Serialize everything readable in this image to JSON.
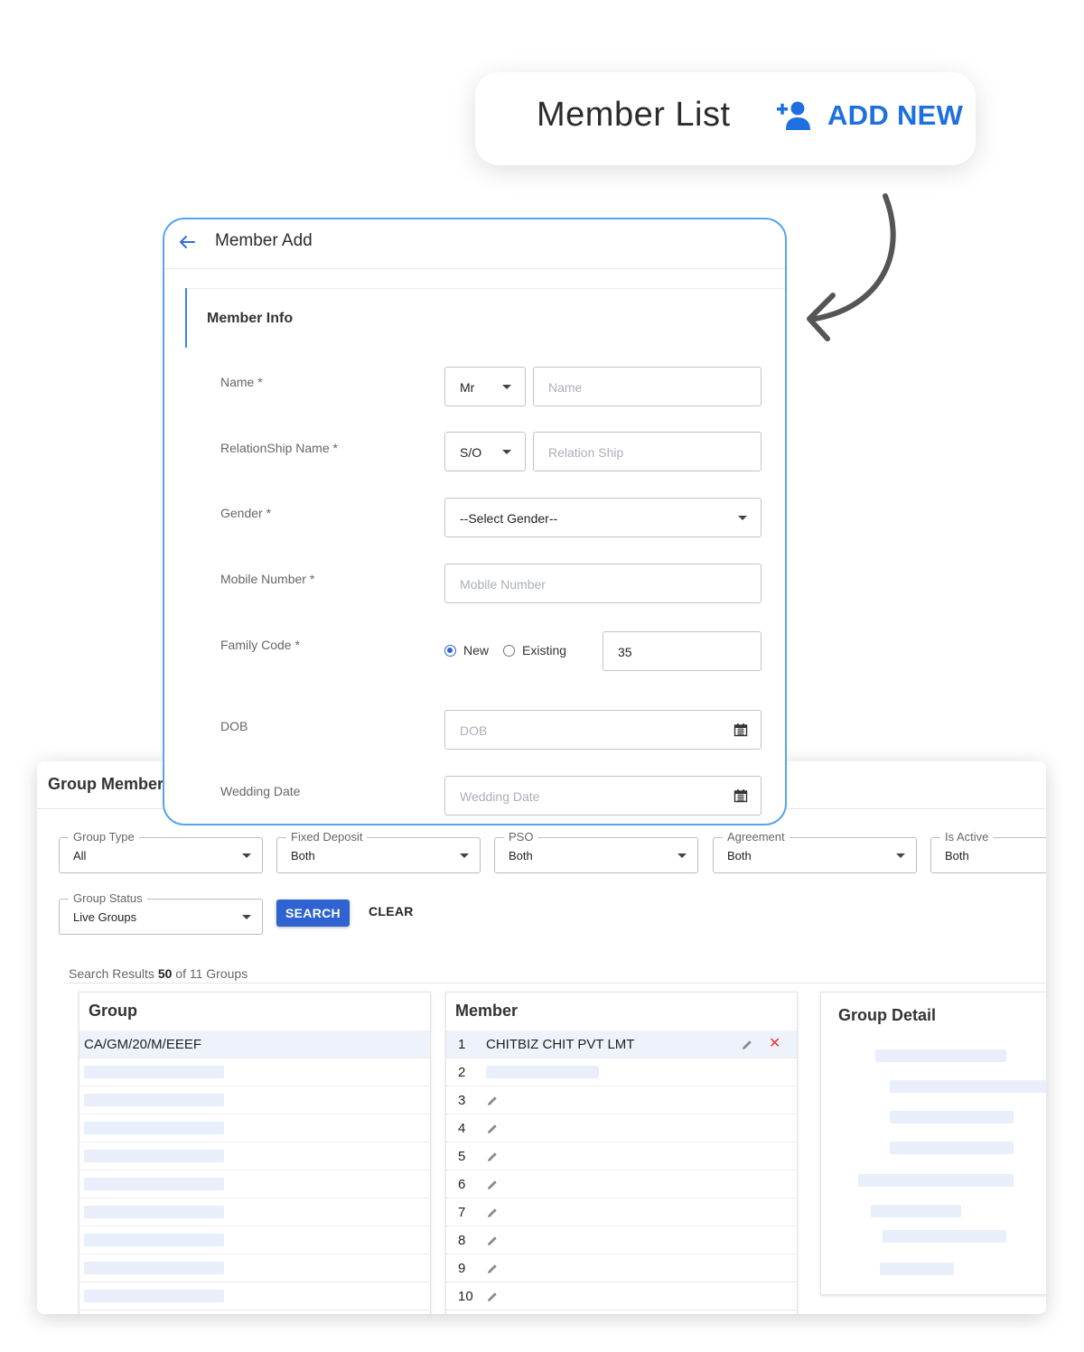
{
  "member_list": {
    "title": "Member List",
    "add_new_label": "ADD NEW",
    "add_icon": "person-add-icon",
    "accent": "#1e6fe0"
  },
  "member_add": {
    "title": "Member Add",
    "section_title": "Member Info",
    "border_color": "#56a4ee",
    "fields": {
      "name": {
        "label": "Name *",
        "title_value": "Mr",
        "placeholder": "Name"
      },
      "relationship": {
        "label": "RelationShip Name *",
        "relation_value": "S/O",
        "placeholder": "Relation Ship"
      },
      "gender": {
        "label": "Gender *",
        "value": "--Select Gender--"
      },
      "mobile": {
        "label": "Mobile Number *",
        "placeholder": "Mobile Number"
      },
      "family_code": {
        "label": "Family Code *",
        "option_new": "New",
        "option_existing": "Existing",
        "selected": "New",
        "value": "35"
      },
      "dob": {
        "label": "DOB",
        "placeholder": "DOB"
      },
      "wedding_date": {
        "label": "Wedding Date",
        "placeholder": "Wedding Date"
      }
    }
  },
  "group_member": {
    "title": "Group Member",
    "filters": [
      {
        "label": "Group Type",
        "value": "All"
      },
      {
        "label": "Fixed Deposit",
        "value": "Both"
      },
      {
        "label": "PSO",
        "value": "Both"
      },
      {
        "label": "Agreement",
        "value": "Both"
      },
      {
        "label": "Is Active",
        "value": "Both"
      },
      {
        "label": "Group Status",
        "value": "Live Groups"
      }
    ],
    "search_label": "SEARCH",
    "clear_label": "CLEAR",
    "results": {
      "prefix": "Search Results",
      "count": "50",
      "suffix": "of 11 Groups"
    },
    "group_column": {
      "header": "Group",
      "selected_row": "CA/GM/20/M/EEEF"
    },
    "member_column": {
      "header": "Member",
      "rows": [
        {
          "num": "1",
          "name": "CHITBIZ CHIT PVT LMT"
        },
        {
          "num": "2"
        },
        {
          "num": "3"
        },
        {
          "num": "4"
        },
        {
          "num": "5"
        },
        {
          "num": "6"
        },
        {
          "num": "7"
        },
        {
          "num": "8"
        },
        {
          "num": "9"
        },
        {
          "num": "10"
        }
      ]
    },
    "detail_column": {
      "header": "Group Detail"
    },
    "primary_color": "#2f63d1",
    "delete_color": "#e53935"
  }
}
